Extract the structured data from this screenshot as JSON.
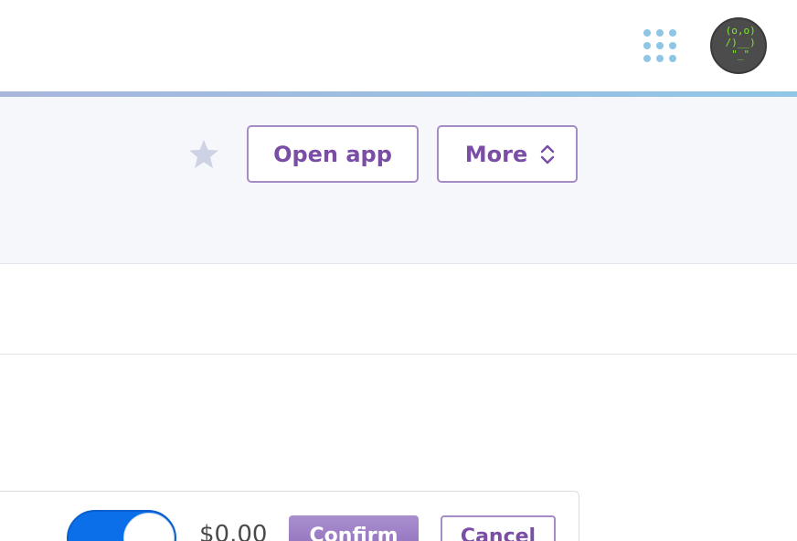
{
  "header": {
    "apps_icon": "grid-dots-icon",
    "avatar_art": " (o,o)\n /)__)\n  \"_\"",
    "colors": {
      "accent_line": "#8fc6e6",
      "apps_icon": "#8fc6e6"
    }
  },
  "toolbar": {
    "star_icon": "star-icon",
    "open_app_label": "Open app",
    "more_label": "More",
    "more_icon": "chevron-up-down-icon",
    "colors": {
      "button_border": "#a48dc4",
      "button_text": "#7a4ea5",
      "star": "#cdd3e4"
    }
  },
  "card": {
    "toggle_on": true,
    "price": "$0.00",
    "confirm_label": "Confirm",
    "cancel_label": "Cancel",
    "colors": {
      "toggle": "#0a6fe8",
      "confirm_bg": "#9a7cc6"
    }
  }
}
